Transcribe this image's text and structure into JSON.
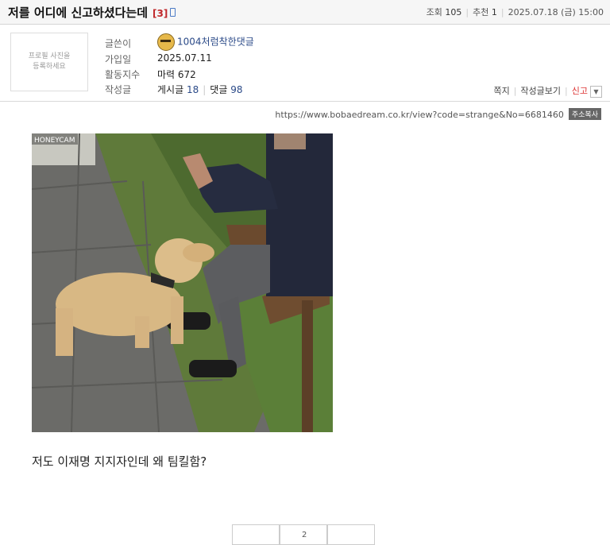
{
  "post": {
    "title": "저를 어디에 신고하셨다는데",
    "comment_count": "[3]",
    "views_label": "조회",
    "views": "105",
    "recommend_label": "추천",
    "recommend": "1",
    "datetime": "2025.07.18 (금) 15:00"
  },
  "profile": {
    "photo_placeholder": "프로필 사진을 등록하세요",
    "labels": {
      "author": "글쓴이",
      "joined": "가입일",
      "activity": "활동지수",
      "posts": "작성글"
    },
    "author": "1004처럼착한댓글",
    "joined": "2025.07.11",
    "activity": "마력 672",
    "post_label": "게시글",
    "post_count": "18",
    "comment_label": "댓글",
    "comment_count": "98"
  },
  "actions": {
    "message": "쪽지",
    "view_posts": "작성글보기",
    "report": "신고"
  },
  "url": {
    "text": "https://www.bobaedream.co.kr/view?code=strange&No=6681460",
    "copy_label": "주소복사"
  },
  "image": {
    "watermark": "HONEYCAM"
  },
  "content": {
    "text": "저도 이재명 지지자인데 왜 팀킬함?"
  },
  "pagination": {
    "current": "2"
  }
}
